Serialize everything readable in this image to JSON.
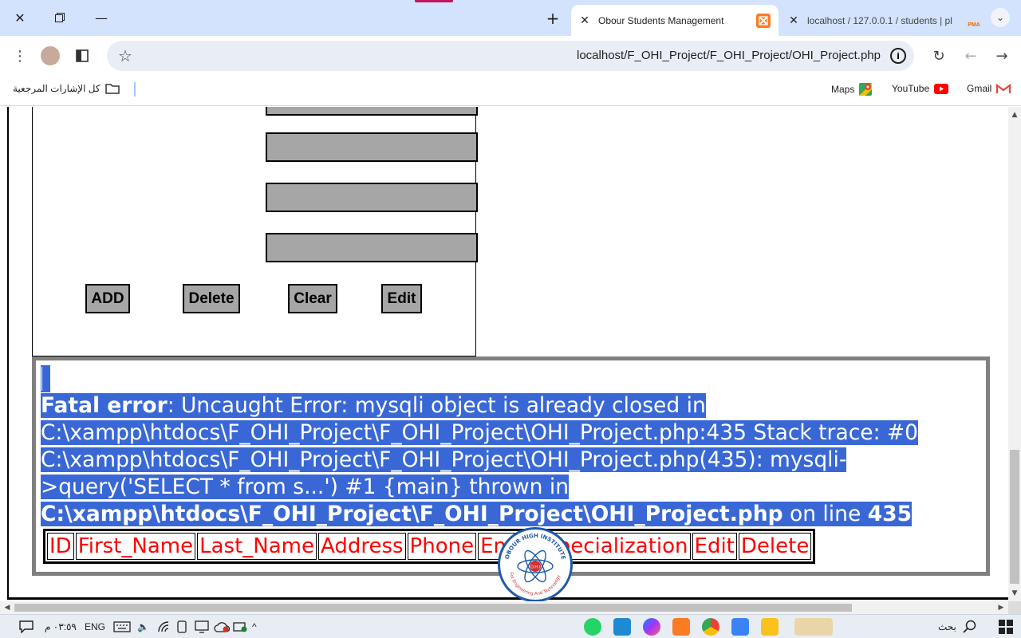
{
  "browser": {
    "tabs": [
      {
        "title": "Obour Students Management",
        "active": true
      },
      {
        "title": "localhost / 127.0.0.1 / students | pl",
        "active": false
      }
    ],
    "url": "localhost/F_OHI_Project/F_OHI_Project/OHI_Project.php",
    "favicon_badge": "PMA",
    "bookmarks": {
      "all_bookmarks": "كل الإشارات المرجعية",
      "maps": "Maps",
      "youtube": "YouTube",
      "gmail": "Gmail"
    }
  },
  "form": {
    "buttons": {
      "add": "ADD",
      "delete": "Delete",
      "clear": "Clear",
      "edit": "Edit"
    }
  },
  "error": {
    "label": "Fatal error",
    "message": ": Uncaught Error: mysqli object is already closed in C:\\xampp\\htdocs\\F_OHI_Project\\F_OHI_Project\\OHI_Project.php:435 Stack trace: #0 C:\\xampp\\htdocs\\F_OHI_Project\\F_OHI_Project\\OHI_Project.php(435): mysqli->query('SELECT * from s...') #1 {main} thrown in",
    "file": "C:\\xampp\\htdocs\\F_OHI_Project\\F_OHI_Project\\OHI_Project.php",
    "on_line": " on line ",
    "line": "435"
  },
  "table": {
    "headers": [
      "ID",
      "First_Name",
      "Last_Name",
      "Address",
      "Phone",
      "Email",
      "Specialization",
      "Edit",
      "Delete"
    ]
  },
  "logo": {
    "top_text": "OBOUR HIGH INSTITUTE",
    "bottom_text": "For Engineering And Technology",
    "center": "O.H.I"
  },
  "taskbar": {
    "search": "بحث",
    "lang": "ENG",
    "time": "٠٣:٥٩ م"
  },
  "colors": {
    "selection": "#3968d6",
    "header_text": "#ff0000",
    "field_gray": "#a6a6a6",
    "chrome_blue": "#d3e3fd"
  }
}
